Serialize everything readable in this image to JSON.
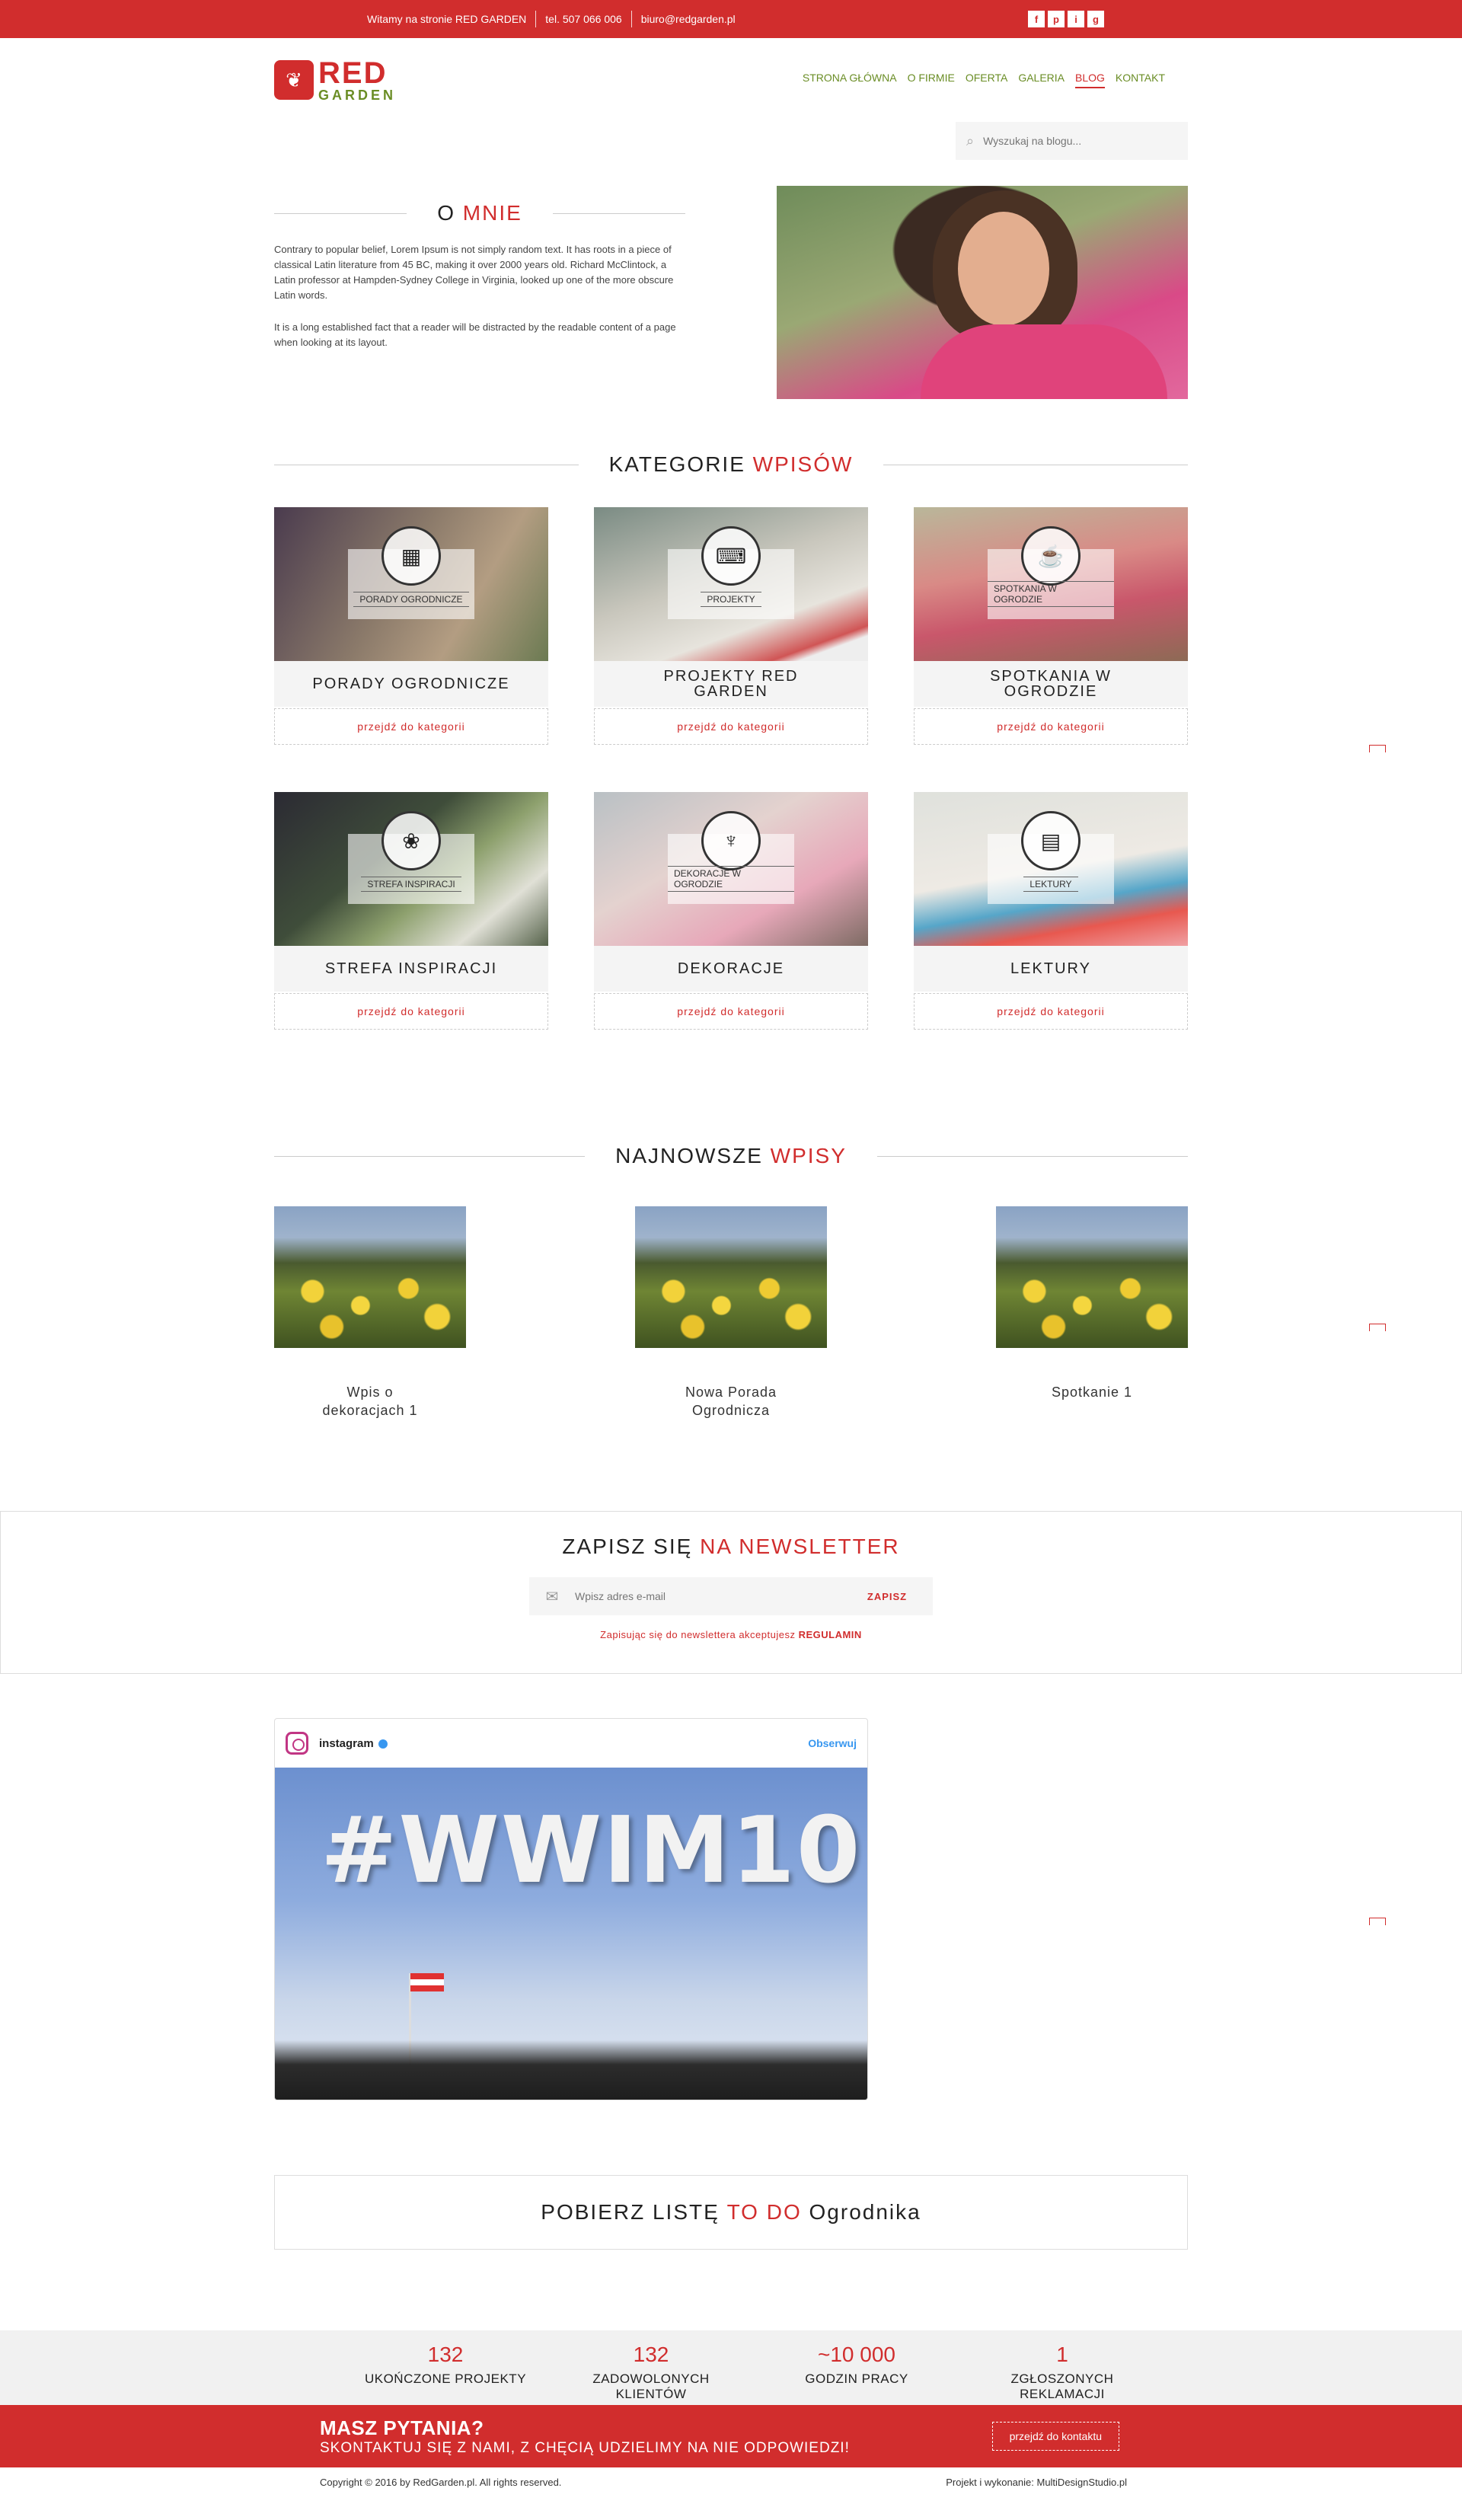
{
  "topbar": {
    "welcome": "Witamy na stronie RED GARDEN",
    "phone": "tel. 507 066 006",
    "email": "biuro@redgarden.pl",
    "social": [
      "f",
      "p",
      "i",
      "g"
    ]
  },
  "logo": {
    "word1": "RED",
    "word2": "GARDEN"
  },
  "nav": [
    "STRONA GŁÓWNA",
    "O FIRMIE",
    "OFERTA",
    "GALERIA",
    "BLOG",
    "KONTAKT"
  ],
  "search": {
    "placeholder": "Wyszukaj na blogu..."
  },
  "about": {
    "title_a": "O",
    "title_b": "MNIE",
    "p1": "Contrary to popular belief, Lorem Ipsum is not simply random text. It has roots in a piece of classical Latin literature from 45 BC, making it over 2000 years old. Richard McClintock, a Latin professor at Hampden-Sydney College in Virginia, looked up one of the more obscure Latin words.",
    "p2": "It is a long established fact that a reader will be distracted by the readable content of a page when looking at its layout."
  },
  "categories": {
    "title_a": "KATEGORIE",
    "title_b": "WPISÓW",
    "button": "przejdź do kategorii",
    "items": [
      {
        "badge": "PORADY OGRODNICZE",
        "name": "PORADY OGRODNICZE",
        "icon": "calendar-icon"
      },
      {
        "badge": "PROJEKTY",
        "name": "PROJEKTY RED GARDEN",
        "icon": "laptop-icon"
      },
      {
        "badge": "SPOTKANIA W OGRODZIE",
        "name": "SPOTKANIA W OGRODZIE",
        "icon": "cup-icon"
      },
      {
        "badge": "STREFA INSPIRACJI",
        "name": "STREFA INSPIRACJI",
        "icon": "plant-icon"
      },
      {
        "badge": "DEKORACJE W OGRODZIE",
        "name": "DEKORACJE",
        "icon": "fountain-icon"
      },
      {
        "badge": "LEKTURY",
        "name": "LEKTURY",
        "icon": "book-icon"
      }
    ]
  },
  "latest": {
    "title_a": "NAJNOWSZE",
    "title_b": "WPISY",
    "posts": [
      "Wpis o dekoracjach 1",
      "Nowa Porada Ogrodnicza",
      "Spotkanie 1"
    ]
  },
  "newsletter": {
    "title_a": "ZAPISZ SIĘ",
    "title_b": "NA NEWSLETTER",
    "placeholder": "Wpisz adres e-mail",
    "button": "ZAPISZ",
    "note": "Zapisując się do newslettera akceptujesz",
    "note_link": "REGULAMIN"
  },
  "instagram": {
    "name": "instagram",
    "follow": "Obserwuj",
    "tag": "#WWIM10"
  },
  "todo": {
    "a": "POBIERZ LISTĘ",
    "b": "TO DO",
    "c": "Ogrodnika"
  },
  "stats": [
    {
      "num": "132",
      "label": "UKOŃCZONE PROJEKTY"
    },
    {
      "num": "132",
      "label": "ZADOWOLONYCH KLIENTÓW"
    },
    {
      "num": "~10 000",
      "label": "GODZIN PRACY"
    },
    {
      "num": "1",
      "label": "ZGŁOSZONYCH REKLAMACJI"
    }
  ],
  "cta": {
    "title": "MASZ PYTANIA?",
    "subtitle": "SKONTAKTUJ SIĘ Z NAMI, Z CHĘCIĄ UDZIELIMY NA NIE ODPOWIEDZI!",
    "button": "przejdź do kontaktu"
  },
  "footer": {
    "copyright": "Copyright © 2016 by RedGarden.pl. All rights reserved.",
    "credits": "Projekt i wykonanie: MultiDesignStudio.pl"
  },
  "colors": {
    "accent": "#d12d2d",
    "green": "#6a8d25"
  }
}
